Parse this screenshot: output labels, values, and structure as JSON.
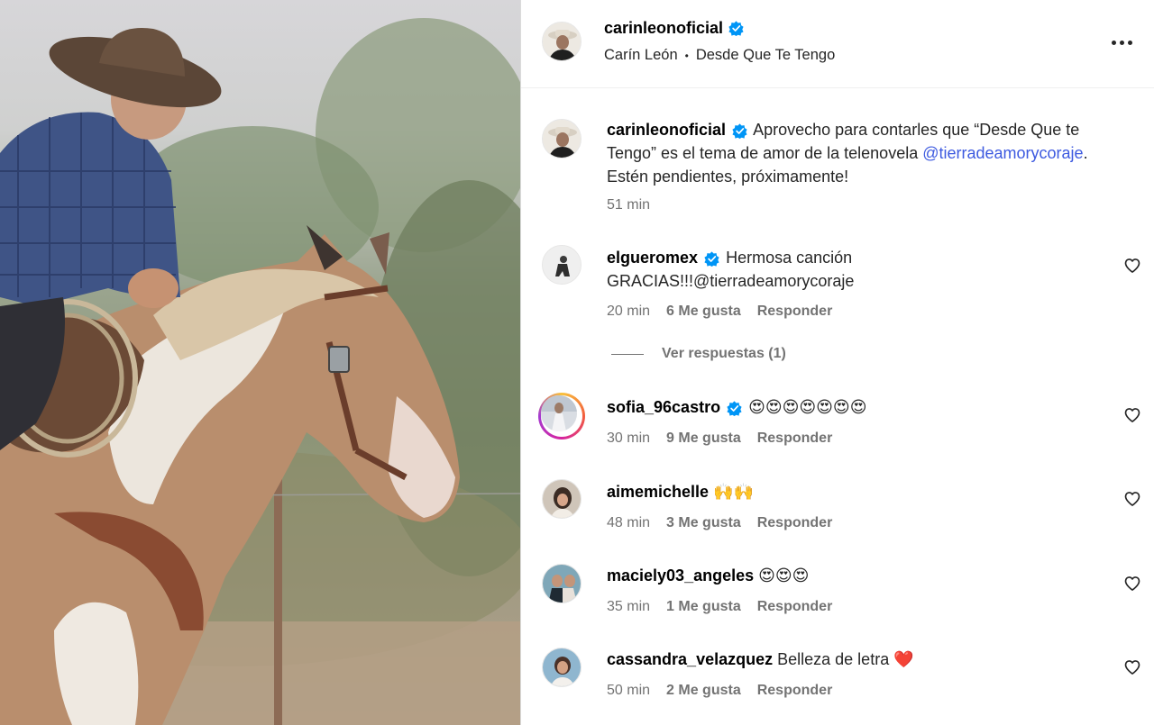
{
  "post": {
    "author": "carinleonoficial",
    "artist": "Carín León",
    "separator": "•",
    "song": "Desde Que Te Tengo"
  },
  "caption": {
    "user": "carinleonoficial",
    "text_before": "Aprovecho para contarles que “Desde Que te Tengo” es el tema de amor de la telenovela ",
    "mention": "@tierradeamorycoraje",
    "text_after": ". Estén pendientes, próximamente!",
    "time": "51 min"
  },
  "comments": [
    {
      "user": "elgueromex",
      "verified": true,
      "text": "Hermosa canción GRACIAS!!!@tierradeamorycoraje",
      "time": "20 min",
      "likes": "6 Me gusta",
      "reply": "Responder"
    },
    {
      "user": "sofia_96castro",
      "verified": true,
      "text": "😍😍😍😍😍😍😍",
      "time": "30 min",
      "likes": "9 Me gusta",
      "reply": "Responder"
    },
    {
      "user": "aimemichelle",
      "verified": false,
      "text": "🙌🙌",
      "time": "48 min",
      "likes": "3 Me gusta",
      "reply": "Responder"
    },
    {
      "user": "maciely03_angeles",
      "verified": false,
      "text": "😍😍😍",
      "time": "35 min",
      "likes": "1 Me gusta",
      "reply": "Responder"
    },
    {
      "user": "cassandra_velazquez",
      "verified": false,
      "text": "Belleza de letra ❤️",
      "time": "50 min",
      "likes": "2 Me gusta",
      "reply": "Responder"
    }
  ],
  "view_replies": "Ver respuestas (1)",
  "icons": {
    "verified": "verified-badge-icon",
    "more": "more-options-icon",
    "like": "heart-icon"
  },
  "colors": {
    "verified": "#0095f6",
    "mention": "#3d5ae0",
    "meta": "#737373"
  }
}
